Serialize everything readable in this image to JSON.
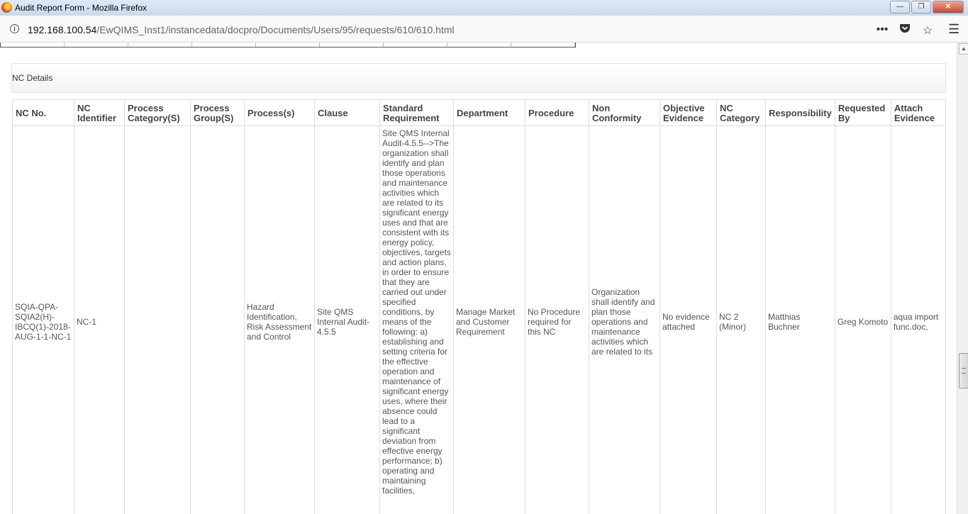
{
  "window": {
    "title": "Audit Report Form - Mozilla Firefox",
    "minimize": "—",
    "maximize": "❐",
    "close": "✕"
  },
  "browser": {
    "url_host": "192.168.100.54",
    "url_path": "/EwQIMS_Inst1/instancedata/docpro/Documents/Users/95/requests/610/610.html",
    "icons": [
      "page-actions-icon",
      "pocket-icon",
      "bookmark-star-icon",
      "menu-icon"
    ]
  },
  "section": {
    "title": "NC Details"
  },
  "table": {
    "headers": {
      "nc_no": "NC No.",
      "nc_identifier": "NC Identifier",
      "process_category": "Process Category(S)",
      "process_group": "Process Group(S)",
      "processes": "Process(s)",
      "clause": "Clause",
      "standard_requirement": "Standard Requirement",
      "department": "Department",
      "procedure": "Procedure",
      "non_conformity": "Non Conformity",
      "objective_evidence": "Objective Evidence",
      "nc_category": "NC Category",
      "responsibility": "Responsibility",
      "requested_by": "Requested By",
      "attach_evidence": "Attach Evidence"
    },
    "row": {
      "nc_no": "SQIA-QPA-SQIA2(H)-IBCQ(1)-2018-AUG-1-1-NC-1",
      "nc_identifier": "NC-1",
      "process_category": "",
      "process_group": "",
      "processes": "Hazard Identification, Risk Assessment and Control",
      "clause": "Site QMS Internal Audit-4.5.5",
      "standard_requirement": "Site QMS Internal Audit-4.5.5-->The organization shall identify and plan those operations and maintenance activities which are related to its significant energy uses and that are consistent with its energy policy, objectives, targets and action plans, in order to ensure that they are carried out under specified conditions, by means of the following: a) establishing and setting criteria for the effective operation and maintenance of significant energy uses, where their absence could lead to a significant deviation from effective energy performance; b) operating and maintaining facilities,",
      "department": "Manage Market and Customer Requirement",
      "procedure": "No Procedure required for this NC",
      "non_conformity": "Organization shall identify and plan those operations and maintenance activities which are related to its",
      "objective_evidence": "No evidence attached",
      "nc_category": "NC 2 (Minor)",
      "responsibility": "Matthias Buchner",
      "requested_by": "Greg Komoto",
      "attach_evidence": "aqua import func.doc,"
    }
  }
}
